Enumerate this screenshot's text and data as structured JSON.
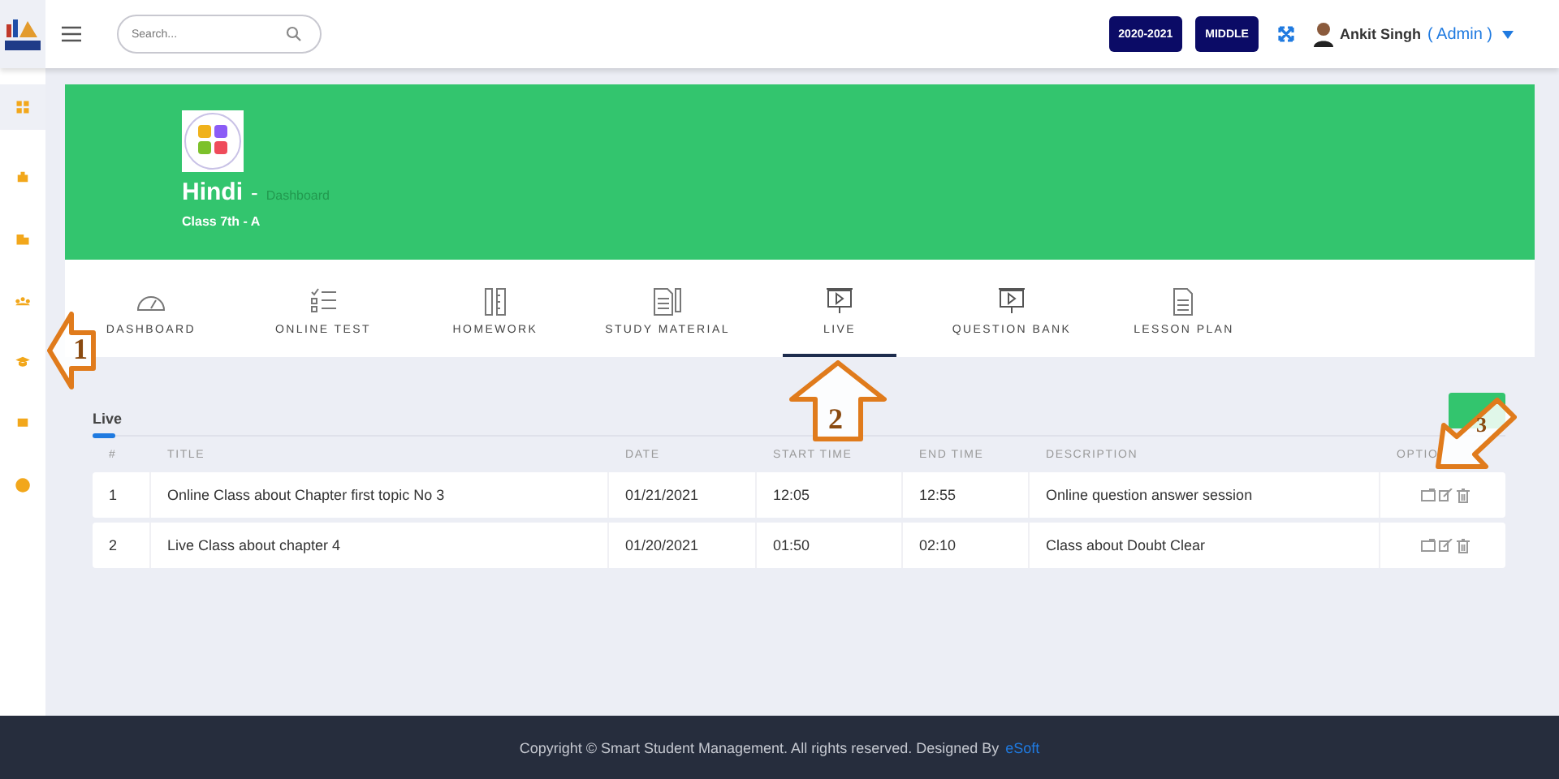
{
  "header": {
    "search": {
      "placeholder": "Search..."
    },
    "session": "2020-2021",
    "level": "MIDDLE",
    "user": {
      "name": "Ankit Singh",
      "role": "( Admin )"
    }
  },
  "sidebar": {
    "items": [
      {
        "selected": true
      },
      {
        "selected": false
      },
      {
        "selected": false
      },
      {
        "selected": false
      },
      {
        "selected": false
      },
      {
        "selected": false
      },
      {
        "selected": false
      }
    ]
  },
  "banner": {
    "subject": "Hindi",
    "separator": "-",
    "page": "Dashboard",
    "class": "Class 7th - A"
  },
  "tabs": [
    {
      "label": "DASHBOARD",
      "selected": false
    },
    {
      "label": "ONLINE TEST",
      "selected": false
    },
    {
      "label": "HOMEWORK",
      "selected": false
    },
    {
      "label": "STUDY MATERIAL",
      "selected": false
    },
    {
      "label": "LIVE",
      "selected": true
    },
    {
      "label": "QUESTION BANK",
      "selected": false
    },
    {
      "label": "LESSON PLAN",
      "selected": false
    }
  ],
  "section": {
    "title": "Live"
  },
  "table": {
    "columns": [
      "#",
      "TITLE",
      "DATE",
      "START TIME",
      "END TIME",
      "DESCRIPTION",
      "OPTIO"
    ],
    "rows": [
      [
        "1",
        "Online Class about Chapter first topic No 3",
        "01/21/2021",
        "12:05",
        "12:55",
        "Online question answer session"
      ],
      [
        "2",
        "Live Class about chapter 4",
        "01/20/2021",
        "01:50",
        "02:10",
        "Class about Doubt Clear"
      ]
    ]
  },
  "footer": {
    "text": "Copyright ©  Smart Student Management. All rights reserved. Designed By",
    "link": "eSoft"
  },
  "annotations": [
    {
      "number": "1",
      "kind": "left"
    },
    {
      "number": "2",
      "kind": "up"
    },
    {
      "number": "3",
      "kind": "downleft"
    }
  ]
}
